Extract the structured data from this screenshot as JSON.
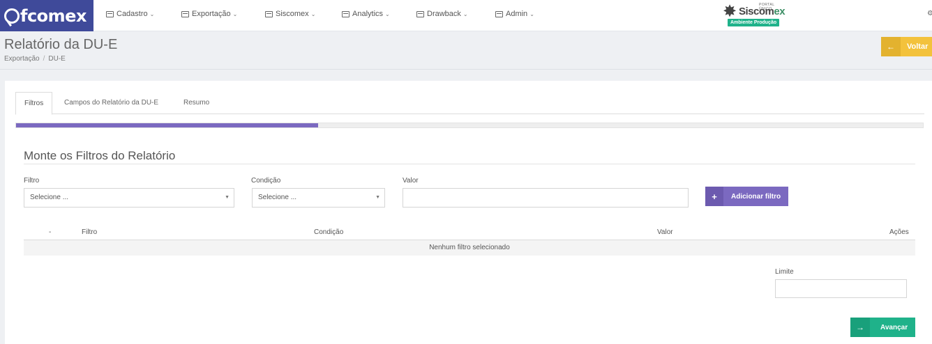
{
  "brand": {
    "logo_text": "fcomex"
  },
  "nav": {
    "items": [
      {
        "label": "Cadastro",
        "icon": "list-icon"
      },
      {
        "label": "Exportação",
        "icon": "list-icon"
      },
      {
        "label": "Siscomex",
        "icon": "list-icon"
      },
      {
        "label": "Analytics",
        "icon": "list-icon"
      },
      {
        "label": "Drawback",
        "icon": "list-icon"
      },
      {
        "label": "Admin",
        "icon": "list-icon"
      }
    ],
    "caret": "⌄"
  },
  "siscomex": {
    "portal_text": "PORTAL ÚNICO",
    "name_main": "Siscom",
    "name_ex": "ex",
    "environment_badge": "Ambiente Produção",
    "badge_color": "#1fb28a"
  },
  "header": {
    "title": "Relatório da DU-E",
    "breadcrumb": [
      "Exportação",
      "DU-E"
    ],
    "back_button": "Voltar",
    "back_color": "#f3c23c"
  },
  "tabs": [
    {
      "label": "Filtros",
      "active": true
    },
    {
      "label": "Campos do Relatório da DU-E",
      "active": false
    },
    {
      "label": "Resumo",
      "active": false
    }
  ],
  "progress": {
    "value": 0.333,
    "color": "#7b69c0"
  },
  "filters": {
    "section_title": "Monte os Filtros do Relatório",
    "filtro_label": "Filtro",
    "filtro_value": "Selecione ...",
    "condicao_label": "Condição",
    "condicao_value": "Selecione ...",
    "valor_label": "Valor",
    "valor_value": "",
    "add_button": "Adicionar filtro"
  },
  "table": {
    "columns": [
      "-",
      "Filtro",
      "Condição",
      "Valor",
      "Ações"
    ],
    "empty_message": "Nenhum filtro selecionado"
  },
  "limit": {
    "label": "Limite",
    "value": ""
  },
  "next_button": "Avançar"
}
